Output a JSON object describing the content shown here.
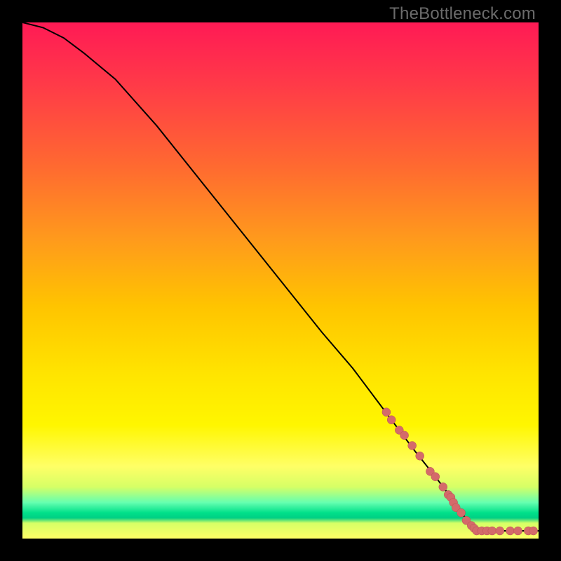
{
  "watermark": "TheBottleneck.com",
  "colors": {
    "curve": "#000000",
    "dot_fill": "#d46a6a",
    "dot_stroke": "#b85252",
    "frame": "#000000"
  },
  "chart_data": {
    "type": "line",
    "title": "",
    "xlabel": "",
    "ylabel": "",
    "xlim": [
      0,
      100
    ],
    "ylim": [
      0,
      100
    ],
    "grid": false,
    "series": [
      {
        "name": "curve",
        "x": [
          0,
          4,
          8,
          12,
          18,
          26,
          34,
          42,
          50,
          58,
          64,
          70,
          76,
          80,
          83,
          85,
          88,
          92,
          96,
          100
        ],
        "y": [
          100,
          99,
          97,
          94,
          89,
          80,
          70,
          60,
          50,
          40,
          33,
          25,
          17,
          12,
          8,
          5,
          1.5,
          1.5,
          1.5,
          1.5
        ]
      },
      {
        "name": "dots_along_curve",
        "type": "scatter",
        "x": [
          70.5,
          71.5,
          73.0,
          74.0,
          75.5,
          77.0,
          79.0,
          80.0,
          81.5,
          82.5,
          83.0,
          83.5,
          84.0,
          85.0,
          86.0,
          87.0,
          87.5,
          88.0,
          89.0,
          90.0,
          91.0,
          92.5,
          94.5,
          96.0,
          98.0,
          99.0
        ],
        "y": [
          24.5,
          23.0,
          21.0,
          20.0,
          18.0,
          16.0,
          13.0,
          12.0,
          10.0,
          8.5,
          8.0,
          7.0,
          6.0,
          5.0,
          3.5,
          2.5,
          2.0,
          1.5,
          1.5,
          1.5,
          1.5,
          1.5,
          1.5,
          1.5,
          1.5,
          1.5
        ]
      }
    ]
  }
}
